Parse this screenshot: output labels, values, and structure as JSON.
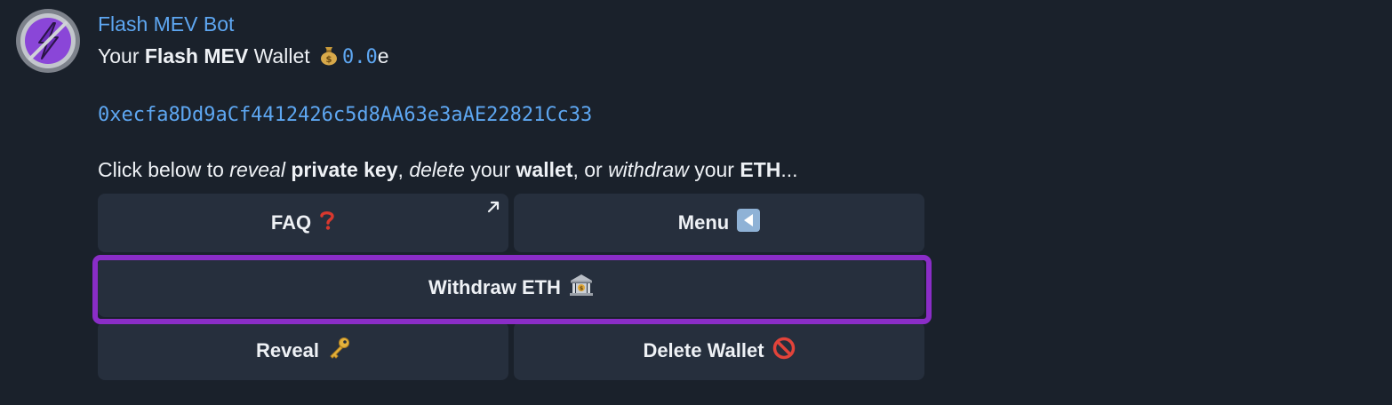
{
  "message": {
    "sender": "Flash MEV Bot",
    "line1": {
      "prefix": "Your ",
      "bold": "Flash MEV",
      "suffix": " Wallet",
      "balance": "0.0",
      "unit": "e"
    },
    "address": "0xecfa8Dd9aCf4412426c5d8AA63e3aAE22821Cc33",
    "instructions": {
      "t1": "Click below to ",
      "i1": "reveal",
      "t2": " ",
      "b1": "private key",
      "t3": ", ",
      "i2": "delete",
      "t4": " your ",
      "b2": "wallet",
      "t5": ", or ",
      "i3": "withdraw",
      "t6": " your ",
      "b3": "ETH",
      "t7": "..."
    }
  },
  "keyboard": {
    "faq_label": "FAQ",
    "menu_label": "Menu",
    "withdraw_label": "Withdraw ETH",
    "reveal_label": "Reveal",
    "delete_label": "Delete Wallet"
  },
  "icons": {
    "avatar": "lightning-bolt-icon",
    "wallet": "money-bag-icon",
    "faq": "red-question-mark-icon",
    "faq_link": "external-link-arrow-icon",
    "menu": "back-arrow-icon",
    "withdraw": "bank-icon",
    "reveal": "key-icon",
    "delete": "prohibited-icon"
  },
  "colors": {
    "background": "#1a212b",
    "button": "#262f3d",
    "link": "#5ea7f2",
    "highlight": "#8a2dc7",
    "avatar_accent": "#8a46d8"
  }
}
